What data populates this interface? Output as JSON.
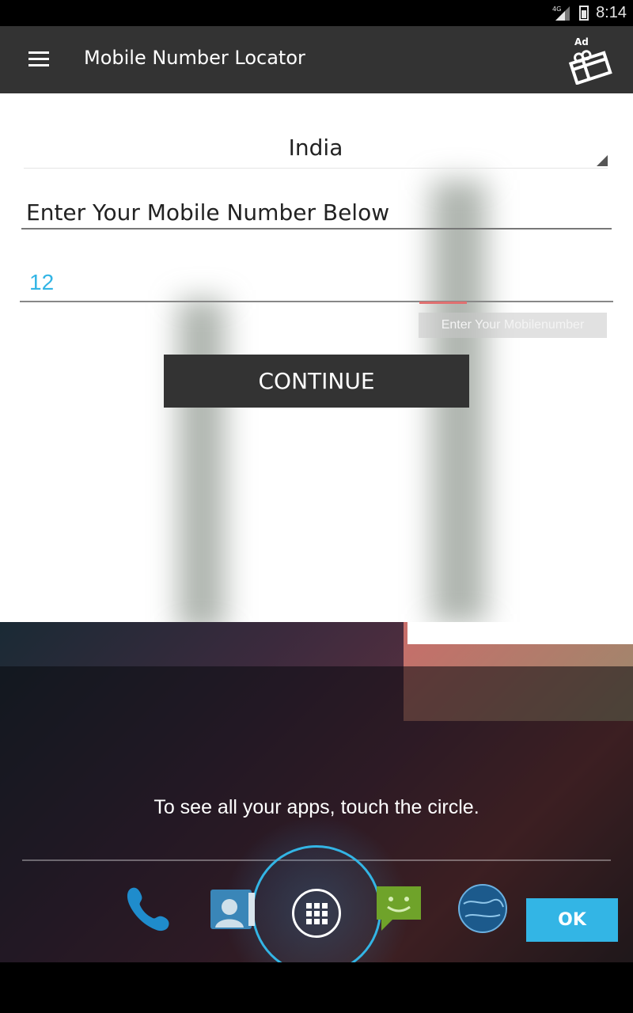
{
  "status_bar": {
    "network": "4G",
    "time": "8:14"
  },
  "toolbar": {
    "title": "Mobile Number Locator",
    "ad_badge": "Ad"
  },
  "form": {
    "country": "India",
    "label": "Enter Your Mobile Number Below",
    "number_value": "12",
    "hint": "Enter Your Mobilenumber",
    "continue_label": "CONTINUE"
  },
  "launcher": {
    "cling_text": "To see all your apps, touch the circle.",
    "ok_label": "OK",
    "dock": [
      "phone-icon",
      "contacts-icon",
      "all-apps-icon",
      "messaging-icon",
      "browser-icon"
    ]
  },
  "colors": {
    "accent": "#33b5e5",
    "toolbar": "#333333"
  }
}
